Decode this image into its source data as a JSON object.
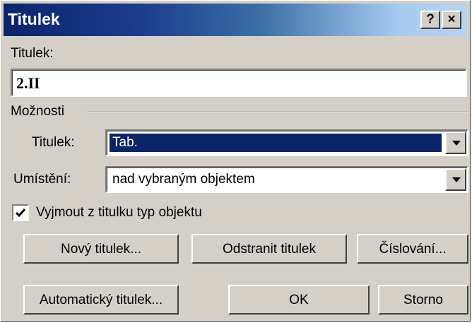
{
  "window": {
    "title": "Titulek",
    "help_label": "?",
    "close_label": "×"
  },
  "caption": {
    "label": "Titulek:",
    "value": "2.II"
  },
  "options": {
    "group_label": "Možnosti",
    "caption_type": {
      "label": "Titulek:",
      "value": "Tab."
    },
    "position": {
      "label": "Umístění:",
      "value": "nad vybraným objektem"
    },
    "exclude_label": {
      "label": "Vyjmout z titulku typ objektu",
      "checked": true
    }
  },
  "buttons": {
    "new_caption": "Nový titulek...",
    "delete_caption": "Odstranit titulek",
    "numbering": "Číslování...",
    "auto_caption": "Automatický titulek...",
    "ok": "OK",
    "cancel": "Storno"
  },
  "colors": {
    "face": "#d4d0c8",
    "titlebar_start": "#0a246a",
    "titlebar_end": "#b8d4ef",
    "selection": "#0a246a"
  }
}
